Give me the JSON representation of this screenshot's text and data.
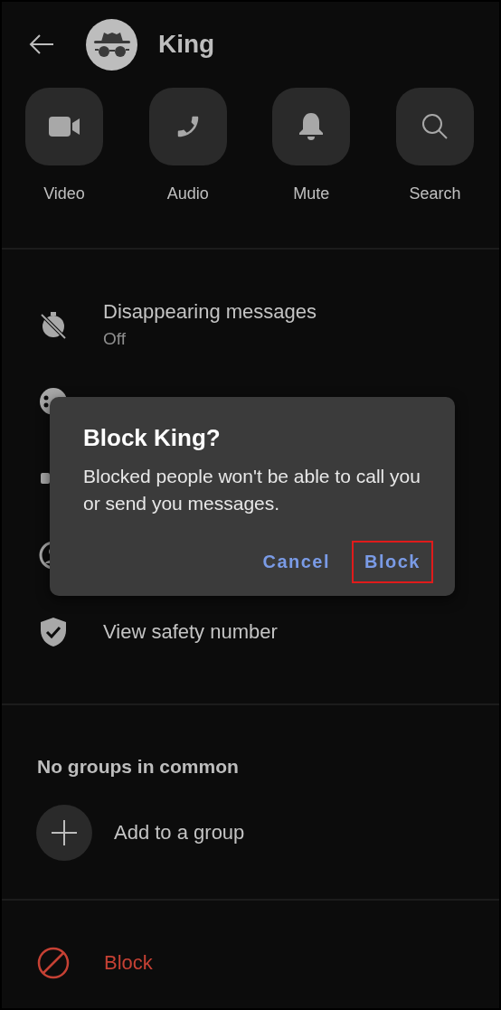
{
  "header": {
    "title": "King"
  },
  "actions": [
    {
      "label": "Video"
    },
    {
      "label": "Audio"
    },
    {
      "label": "Mute"
    },
    {
      "label": "Search"
    }
  ],
  "settings": [
    {
      "kind": "text",
      "title": "Disappearing messages",
      "subtitle": "Off"
    },
    {
      "kind": "covered"
    },
    {
      "kind": "covered"
    },
    {
      "kind": "covered"
    },
    {
      "kind": "text",
      "title": "View safety number"
    }
  ],
  "groups": {
    "heading": "No groups in common",
    "add_label": "Add to a group"
  },
  "block_row": {
    "label": "Block"
  },
  "dialog": {
    "title": "Block King?",
    "message": "Blocked people won't be able to call you or send you messages.",
    "buttons": [
      {
        "label": "Cancel",
        "highlighted": false
      },
      {
        "label": "Block",
        "highlighted": true
      }
    ]
  }
}
